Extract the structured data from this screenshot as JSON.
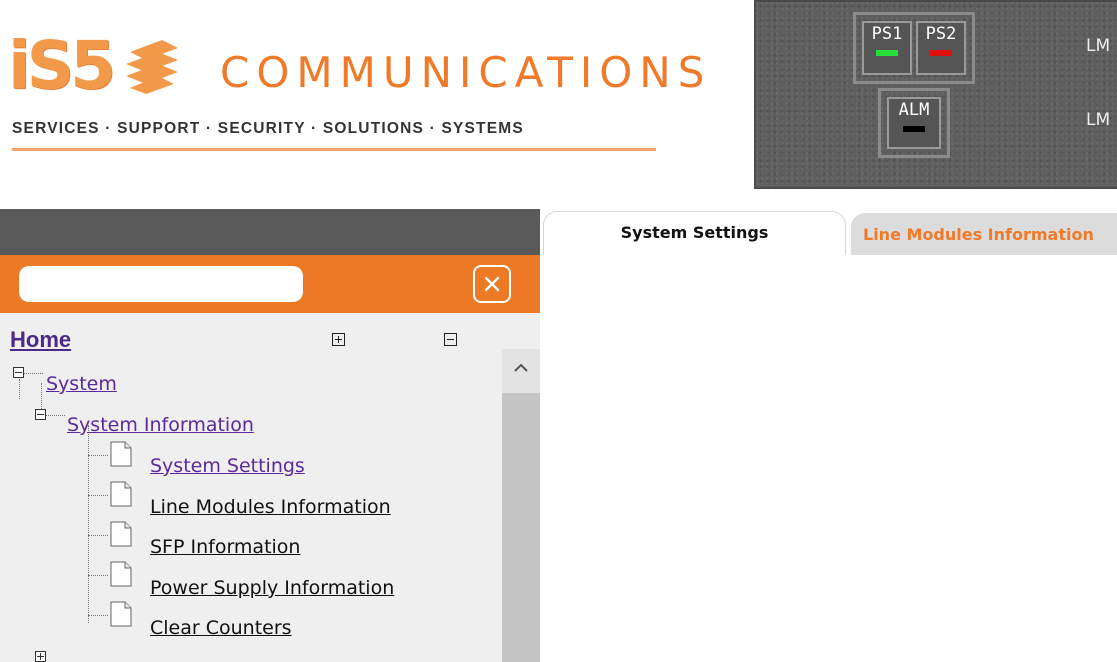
{
  "header": {
    "logo_mark": "iS5",
    "company": "COMMUNICATIONS",
    "tagline": "SERVICES · SUPPORT · SECURITY · SOLUTIONS · SYSTEMS"
  },
  "device_panel": {
    "leds": [
      {
        "label": "PS1",
        "color": "#27e03a"
      },
      {
        "label": "PS2",
        "color": "#e01010"
      },
      {
        "label": "ALM",
        "color": "#000000"
      }
    ],
    "line_labels": [
      "LM",
      "LM"
    ]
  },
  "tabs": [
    {
      "label": "System Settings",
      "active": true
    },
    {
      "label": "Line Modules Information",
      "active": false
    }
  ],
  "sidebar": {
    "search": {
      "value": "",
      "placeholder": ""
    },
    "home_label": "Home",
    "tree": [
      {
        "label": "System",
        "level": 0,
        "expanded": true
      },
      {
        "label": "System Information",
        "level": 1,
        "expanded": true
      },
      {
        "label": "System Settings",
        "level": 2,
        "visited": true
      },
      {
        "label": "Line Modules Information",
        "level": 2,
        "visited": false
      },
      {
        "label": "SFP Information",
        "level": 2,
        "visited": false
      },
      {
        "label": "Power Supply Information",
        "level": 2,
        "visited": false
      },
      {
        "label": "Clear Counters",
        "level": 2,
        "visited": false
      }
    ]
  },
  "colors": {
    "accent_orange": "#ec7a24",
    "band_gray": "#595959",
    "link_purple": "#5a2a9c"
  }
}
